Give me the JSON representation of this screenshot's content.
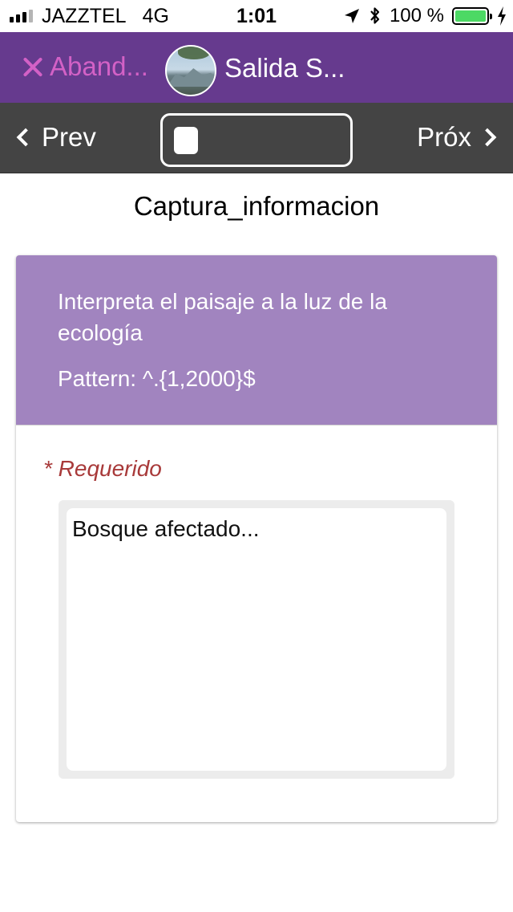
{
  "status_bar": {
    "carrier": "JAZZTEL",
    "network": "4G",
    "time": "1:01",
    "battery_text": "100 %",
    "battery_level": 1.0,
    "icons": [
      "signal-icon",
      "location-arrow-icon",
      "bluetooth-icon",
      "battery-icon",
      "charging-bolt-icon"
    ]
  },
  "header": {
    "abandon_label": "Aband...",
    "form_title": "Salida S...",
    "colors": {
      "background": "#663a8e",
      "abandon": "#d361c6"
    }
  },
  "nav": {
    "prev_label": "Prev",
    "next_label": "Próx",
    "progress_fraction": 0.05
  },
  "content": {
    "page_heading": "Captura_informacion",
    "question": "Interpreta el paisaje a la luz de la ecología",
    "pattern": "Pattern: ^.{1,2000}$",
    "required_label": "* Requerido",
    "answer_value": "Bosque afectado...",
    "colors": {
      "card_header": "#a184bf",
      "required": "#a83a3a"
    }
  }
}
